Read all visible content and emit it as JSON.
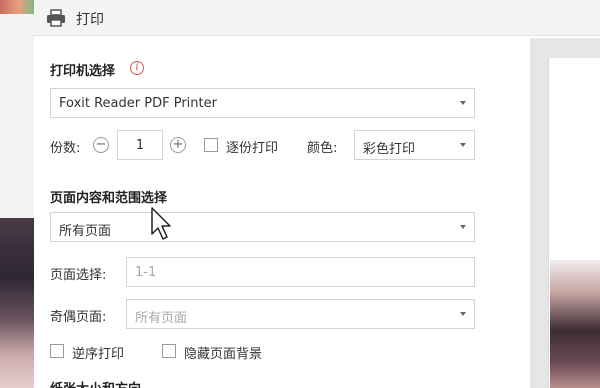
{
  "dialog": {
    "title": "打印"
  },
  "printer_section": {
    "title": "打印机选择",
    "info_icon": "info-icon",
    "printer_value": "Foxit Reader PDF Printer"
  },
  "copies": {
    "label": "份数:",
    "value": "1",
    "minus": "−",
    "plus": "+",
    "collate_label": "逐份打印",
    "color_label": "颜色:",
    "color_value": "彩色打印"
  },
  "range_section": {
    "title": "页面内容和范围选择",
    "content_value": "所有页面",
    "page_select_label": "页面选择:",
    "page_select_placeholder": "1-1",
    "odd_even_label": "奇偶页面:",
    "odd_even_value": "所有页面",
    "reverse_label": "逆序打印",
    "hide_bg_label": "隐藏页面背景"
  },
  "paper_section": {
    "title": "纸张大小和方向"
  }
}
